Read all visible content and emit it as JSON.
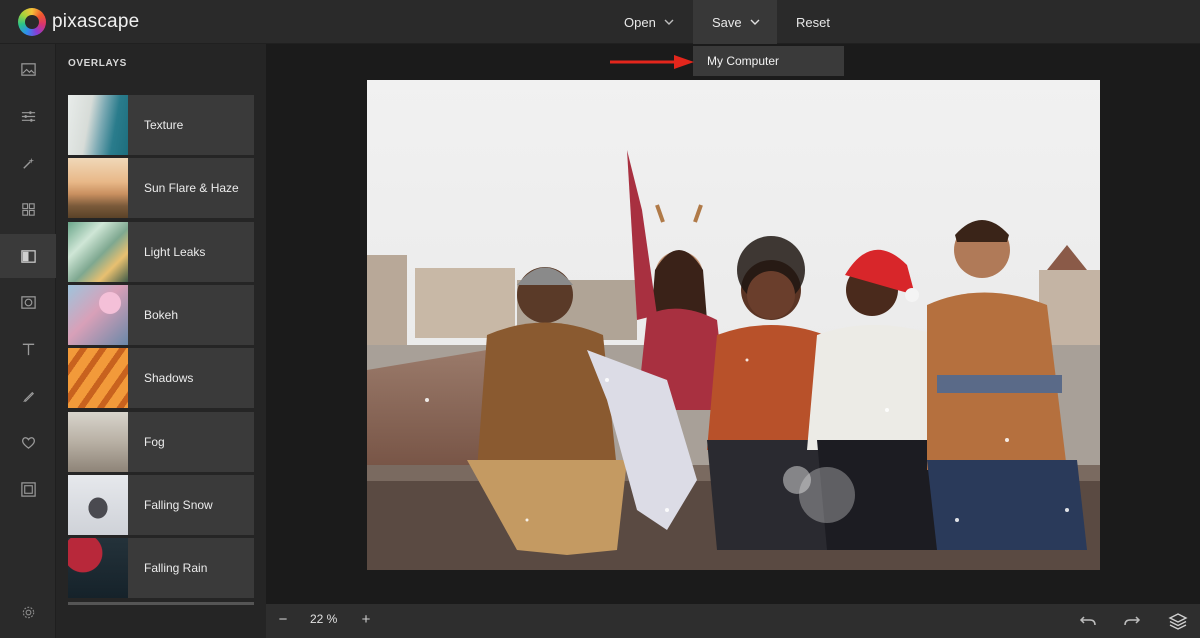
{
  "app": {
    "name": "pixascape"
  },
  "topbar": {
    "menus": [
      {
        "label": "Open"
      },
      {
        "label": "Save"
      },
      {
        "label": "Reset"
      }
    ],
    "save_dropdown": {
      "items": [
        {
          "label": "My Computer"
        }
      ]
    }
  },
  "sidebar": {
    "tools": [
      {
        "icon": "image-icon"
      },
      {
        "icon": "sliders-icon"
      },
      {
        "icon": "magic-wand-icon"
      },
      {
        "icon": "grid-icon"
      },
      {
        "icon": "overlay-icon",
        "active": true
      },
      {
        "icon": "vignette-icon"
      },
      {
        "icon": "text-icon"
      },
      {
        "icon": "brush-icon"
      },
      {
        "icon": "heart-icon"
      },
      {
        "icon": "frame-icon"
      },
      {
        "icon": "settings-icon"
      }
    ]
  },
  "overlays": {
    "title": "OVERLAYS",
    "items": [
      {
        "label": "Texture"
      },
      {
        "label": "Sun Flare & Haze"
      },
      {
        "label": "Light Leaks"
      },
      {
        "label": "Bokeh"
      },
      {
        "label": "Shadows"
      },
      {
        "label": "Fog"
      },
      {
        "label": "Falling Snow"
      },
      {
        "label": "Falling Rain"
      }
    ]
  },
  "bottombar": {
    "zoom": "22 %",
    "zoom_out": "−",
    "zoom_in": "+"
  },
  "colors": {
    "accent_arrow": "#e3261c",
    "panel_bg": "#252525",
    "topbar_bg": "#2a2a2a"
  }
}
